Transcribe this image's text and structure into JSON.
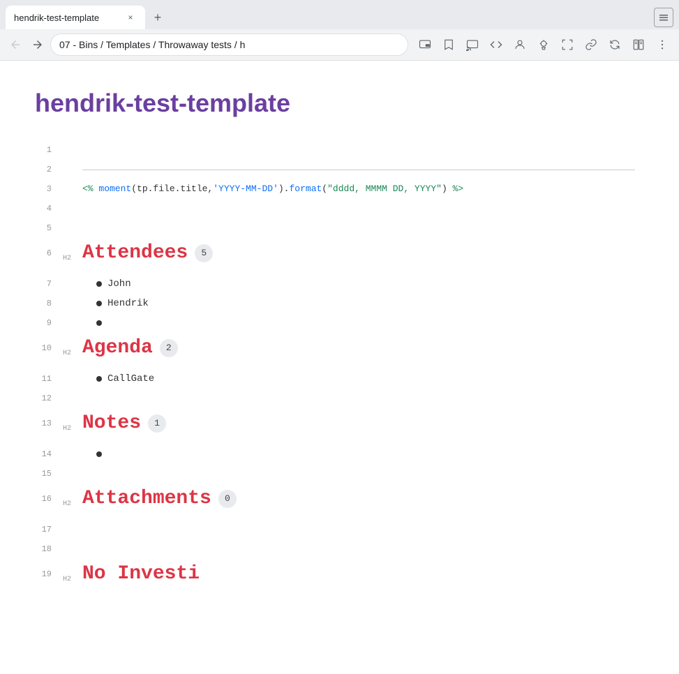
{
  "browser": {
    "tab_title": "hendrik-test-template",
    "tab_close_label": "×",
    "new_tab_label": "+",
    "tab_right_btn": "⌗",
    "nav": {
      "back": "←",
      "forward": "→"
    },
    "breadcrumb": "07 - Bins / Templates / Throwaway tests / h",
    "toolbar_icons": [
      "⧉",
      "🔖",
      "⬜",
      "</>",
      "🙂",
      "💡",
      "⤢",
      "🔗",
      "↻",
      "📖",
      "⋮"
    ]
  },
  "page": {
    "title": "hendrik-test-template"
  },
  "lines": [
    {
      "number": "1",
      "tag": "",
      "type": "empty",
      "content": ""
    },
    {
      "number": "2",
      "tag": "",
      "type": "separator",
      "content": ""
    },
    {
      "number": "3",
      "tag": "",
      "type": "code",
      "content": "<% moment(tp.file.title,'YYYY-MM-DD').format(\"dddd, MMMM DD, YYYY\") %>"
    },
    {
      "number": "4",
      "tag": "",
      "type": "empty",
      "content": ""
    },
    {
      "number": "5",
      "tag": "",
      "type": "empty",
      "content": ""
    }
  ],
  "sections": [
    {
      "line_number": "6",
      "tag": "H2",
      "heading": "Attendees",
      "badge": "5",
      "items": [
        {
          "line": "7",
          "text": "John"
        },
        {
          "line": "8",
          "text": "Hendrik"
        },
        {
          "line": "9",
          "text": ""
        }
      ],
      "gap_lines": []
    },
    {
      "line_number": "10",
      "tag": "H2",
      "heading": "Agenda",
      "badge": "2",
      "items": [
        {
          "line": "11",
          "text": "CallGate"
        },
        {
          "line": "12",
          "text": ""
        }
      ]
    },
    {
      "line_number": "13",
      "tag": "H2",
      "heading": "Notes",
      "badge": "1",
      "items": [
        {
          "line": "14",
          "text": ""
        },
        {
          "line": "15",
          "text": ""
        }
      ]
    },
    {
      "line_number": "16",
      "tag": "H2",
      "heading": "Attachments",
      "badge": "0",
      "items": [
        {
          "line": "17",
          "text": ""
        },
        {
          "line": "18",
          "text": ""
        }
      ]
    }
  ],
  "partial_section": {
    "line_number": "19",
    "tag": "H2",
    "heading": "No Investions",
    "heading_partial": "No Investi"
  }
}
